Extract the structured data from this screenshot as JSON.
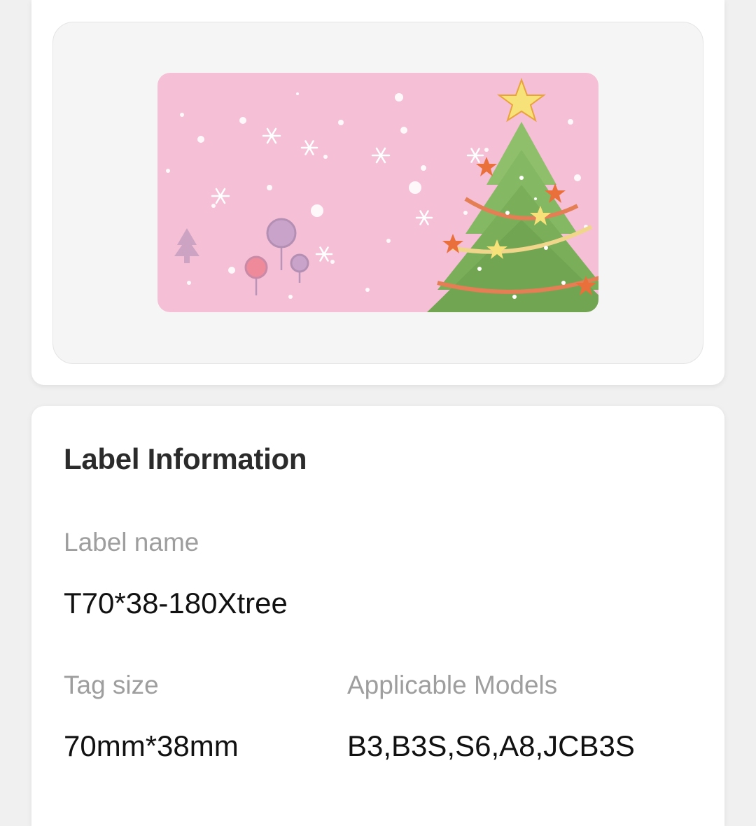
{
  "preview": {
    "image_description_icon": "christmas-tree-label-image",
    "background_color": "#f5bfd6"
  },
  "info": {
    "title": "Label Information",
    "label_name_caption": "Label name",
    "label_name_value": "T70*38-180Xtree",
    "tag_size_caption": "Tag size",
    "tag_size_value": "70mm*38mm",
    "models_caption": "Applicable Models",
    "models_value": "B3,B3S,S6,A8,JCB3S"
  }
}
